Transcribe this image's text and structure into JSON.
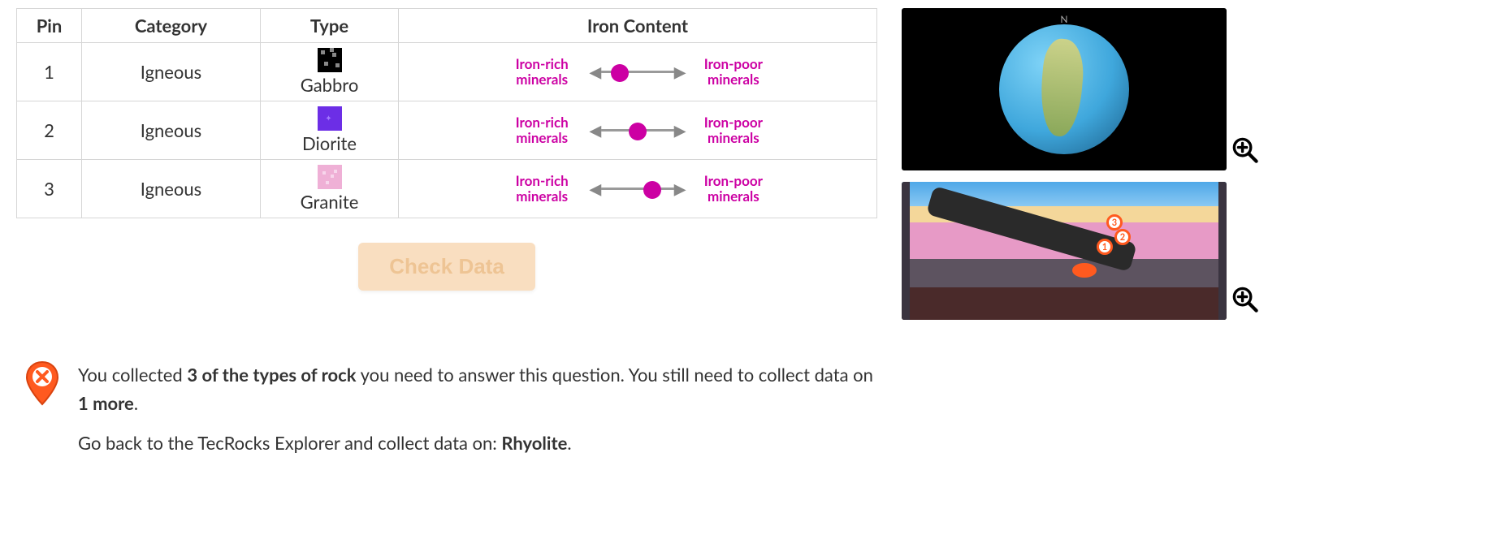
{
  "table": {
    "headers": {
      "pin": "Pin",
      "category": "Category",
      "type": "Type",
      "iron": "Iron Content"
    },
    "iron_slider": {
      "left_label": "Iron-rich\nminerals",
      "right_label": "Iron-poor\nminerals"
    },
    "rows": [
      {
        "pin": "1",
        "category": "Igneous",
        "type": "Gabbro",
        "swatch": "sw-gabbro",
        "slider_pos": 0.25
      },
      {
        "pin": "2",
        "category": "Igneous",
        "type": "Diorite",
        "swatch": "sw-diorite",
        "slider_pos": 0.5
      },
      {
        "pin": "3",
        "category": "Igneous",
        "type": "Granite",
        "swatch": "sw-granite",
        "slider_pos": 0.7
      }
    ]
  },
  "buttons": {
    "check_data": "Check Data"
  },
  "thumbnails": {
    "globe_compass": "N",
    "cross_section_pins": [
      "1",
      "2",
      "3"
    ]
  },
  "feedback": {
    "line1_pre": "You collected ",
    "line1_bold1": "3 of the types of rock",
    "line1_mid": " you need to answer this question. You still need to collect data on ",
    "line1_bold2": "1 more",
    "line1_post": ".",
    "line2_pre": "Go back to the TecRocks Explorer and collect data on: ",
    "line2_bold": "Rhyolite",
    "line2_post": "."
  }
}
